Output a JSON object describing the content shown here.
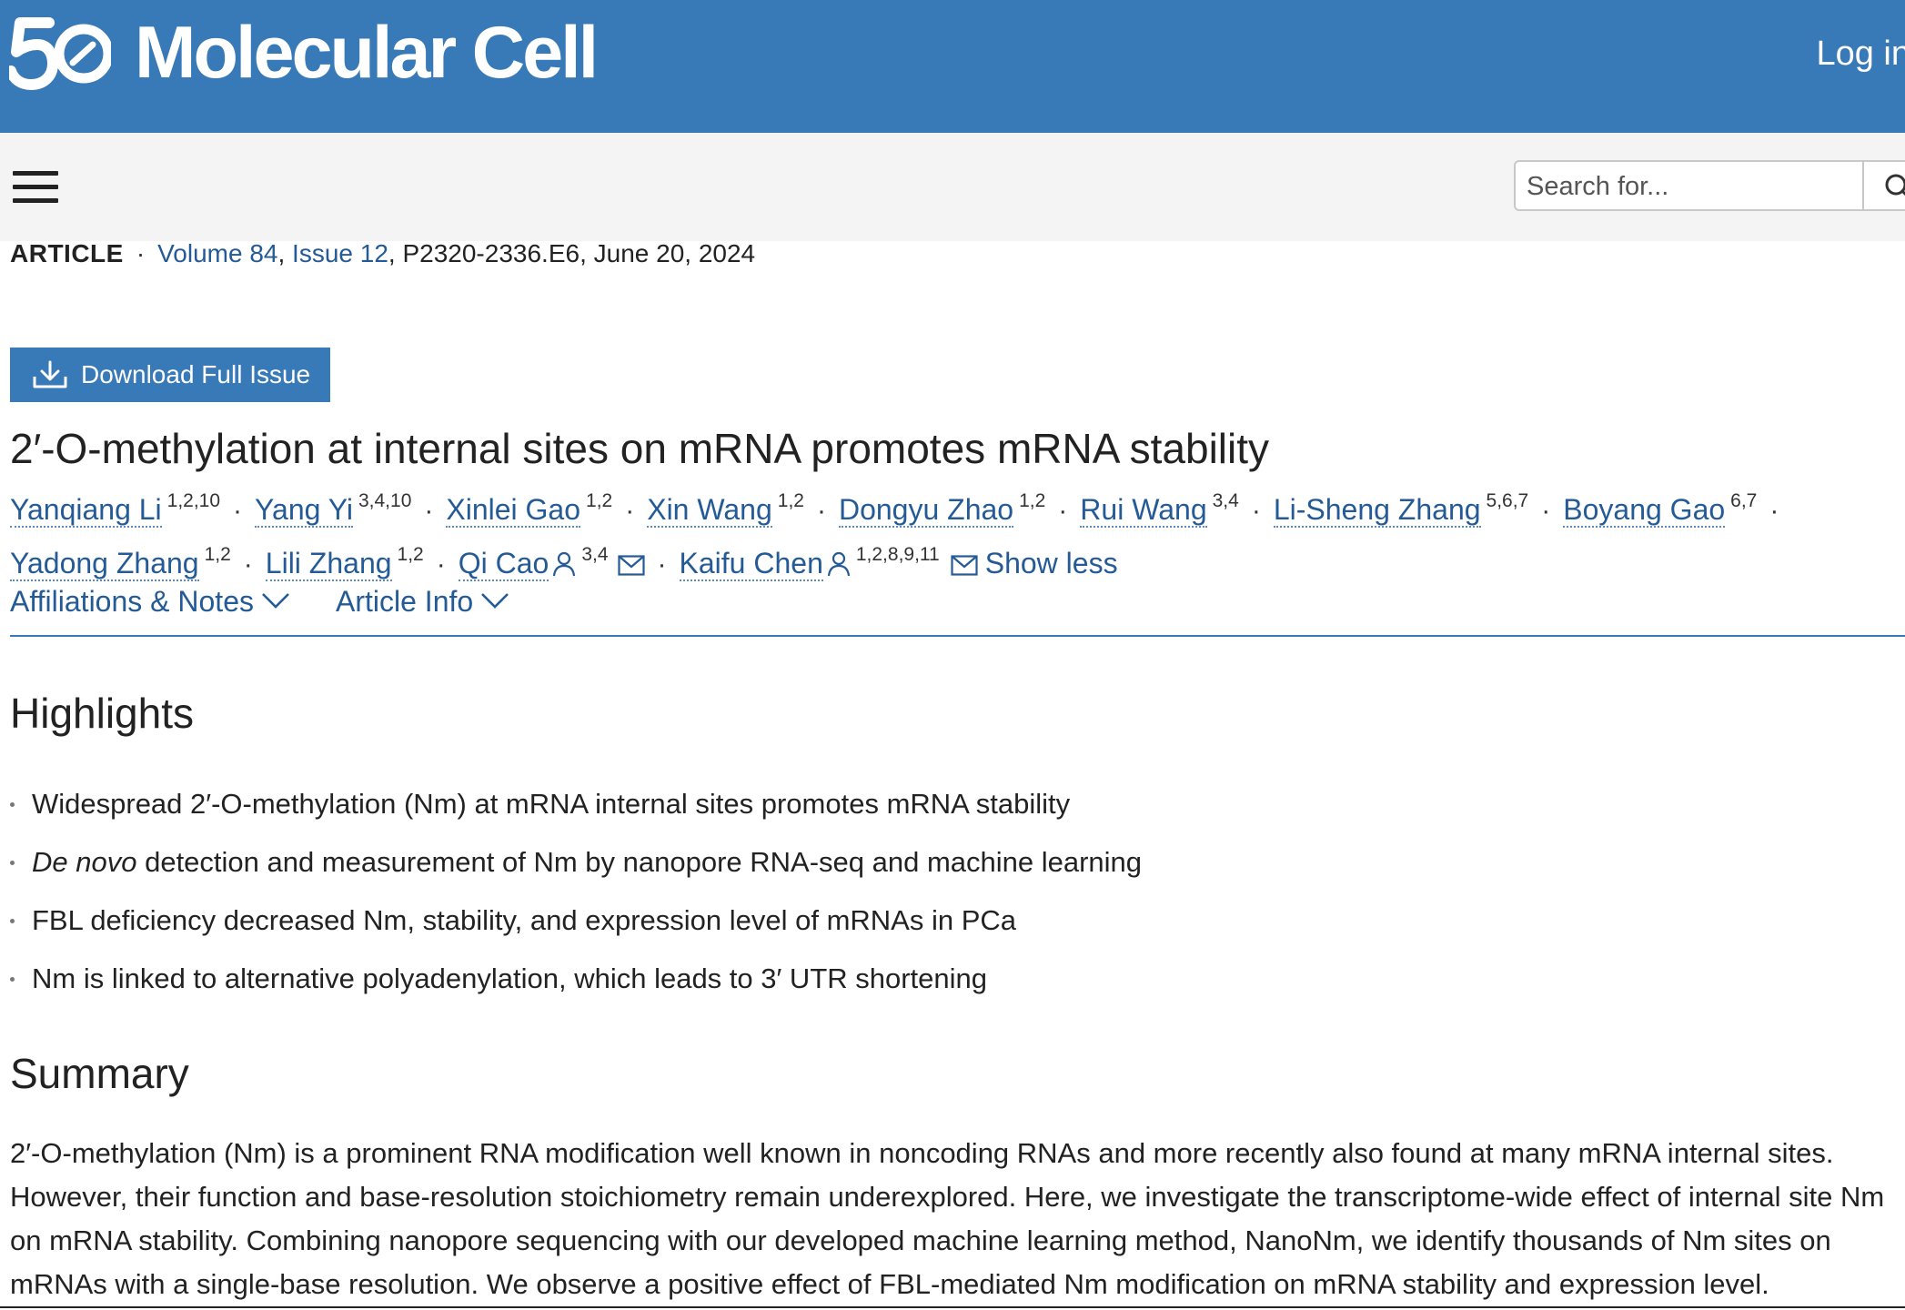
{
  "header": {
    "brand_name": "Molecular Cell",
    "logo_text": "50",
    "login_label": "Log in",
    "bar_color": "#3879b7"
  },
  "nav": {
    "menu_icon": "hamburger-icon",
    "search_placeholder": "Search for...",
    "search_icon": "search-icon"
  },
  "article": {
    "type": "ARTICLE",
    "volume": "Volume 84",
    "issue": "Issue 12",
    "pages_date": ", P2320-2336.E6, June 20, 2024",
    "download_label": "Download Full Issue",
    "title": "2′-O-methylation at internal sites on mRNA promotes mRNA stability",
    "authors": [
      {
        "name": "Yanqiang Li",
        "sup": "1,2,10"
      },
      {
        "name": "Yang Yi",
        "sup": "3,4,10"
      },
      {
        "name": "Xinlei Gao",
        "sup": "1,2"
      },
      {
        "name": "Xin Wang",
        "sup": "1,2"
      },
      {
        "name": "Dongyu Zhao",
        "sup": "1,2"
      },
      {
        "name": "Rui Wang",
        "sup": "3,4"
      },
      {
        "name": "Li-Sheng Zhang",
        "sup": "5,6,7"
      },
      {
        "name": "Boyang Gao",
        "sup": "6,7"
      },
      {
        "name": "Yadong Zhang",
        "sup": "1,2"
      },
      {
        "name": "Lili Zhang",
        "sup": "1,2"
      },
      {
        "name": "Qi Cao",
        "sup": "3,4"
      },
      {
        "name": "Kaifu Chen",
        "sup": "1,2,8,9,11"
      }
    ],
    "show_less_label": "Show less",
    "tabs": [
      {
        "label": "Affiliations & Notes"
      },
      {
        "label": "Article Info"
      }
    ]
  },
  "highlights": {
    "heading": "Highlights",
    "items": [
      {
        "em": "",
        "text": "Widespread 2′-O-methylation (Nm) at mRNA internal sites promotes mRNA stability"
      },
      {
        "em": "De novo",
        "text": " detection and measurement of Nm by nanopore RNA-seq and machine learning"
      },
      {
        "em": "",
        "text": "FBL deficiency decreased Nm, stability, and expression level of mRNAs in PCa"
      },
      {
        "em": "",
        "text": "Nm is linked to alternative polyadenylation, which leads to 3′ UTR shortening"
      }
    ]
  },
  "summary": {
    "heading": "Summary",
    "text": "2′-O-methylation (Nm) is a prominent RNA modification well known in noncoding RNAs and more recently also found at many mRNA internal sites. However, their function and base-resolution stoichiometry remain underexplored. Here, we investigate the transcriptome-wide effect of internal site Nm on mRNA stability. Combining nanopore sequencing with our developed machine learning method, NanoNm, we identify thousands of Nm sites on mRNAs with a single-base resolution. We observe a positive effect of FBL-mediated Nm modification on mRNA stability and expression level."
  }
}
